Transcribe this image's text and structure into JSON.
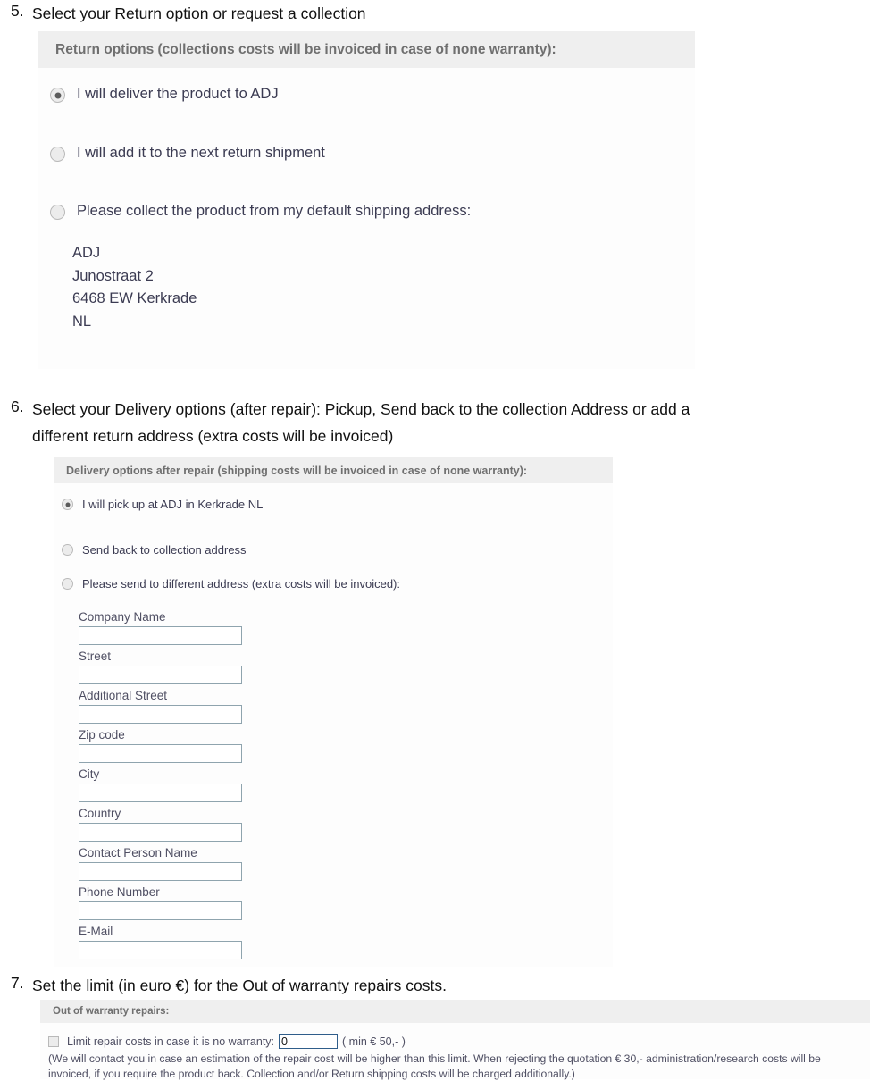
{
  "steps": [
    {
      "number": "5.",
      "text": "Select your Return option or request a collection"
    },
    {
      "number": "6.",
      "line1": "Select your Delivery options (after repair): Pickup, Send back to the collection Address or add a",
      "line2": "different return address (extra costs will be invoiced)"
    },
    {
      "number": "7.",
      "text": "Set the limit (in euro €) for the Out of warranty repairs costs."
    }
  ],
  "return_panel": {
    "header": "Return options (collections costs will be invoiced in case of none warranty):",
    "options": [
      {
        "label": "I will deliver the product to ADJ",
        "selected": true
      },
      {
        "label": "I will add it to the next return shipment",
        "selected": false
      },
      {
        "label": "Please collect the product from my default shipping address:",
        "selected": false
      }
    ],
    "address": {
      "company": "ADJ",
      "street": "Junostraat 2",
      "city_line": "6468 EW Kerkrade",
      "country": "NL"
    }
  },
  "delivery_panel": {
    "header": "Delivery options after repair (shipping costs will be invoiced in case of none warranty):",
    "options": [
      {
        "label": "I will pick up at ADJ in Kerkrade NL",
        "selected": true
      },
      {
        "label": "Send back to collection address",
        "selected": false
      },
      {
        "label": "Please send to different address (extra costs will be invoiced):",
        "selected": false
      }
    ],
    "fields": [
      {
        "label": "Company Name",
        "value": ""
      },
      {
        "label": "Street",
        "value": ""
      },
      {
        "label": "Additional Street",
        "value": ""
      },
      {
        "label": "Zip code",
        "value": ""
      },
      {
        "label": "City",
        "value": ""
      },
      {
        "label": "Country",
        "value": ""
      },
      {
        "label": "Contact Person Name",
        "value": ""
      },
      {
        "label": "Phone Number",
        "value": ""
      },
      {
        "label": "E-Mail",
        "value": ""
      }
    ]
  },
  "warranty_panel": {
    "header": "Out of warranty repairs:",
    "checkbox_checked": false,
    "checkbox_label": "Limit repair costs in case it is no warranty:",
    "limit_value": "0",
    "limit_hint": "( min € 50,- )",
    "note_line1": "(We will contact you in case an estimation of the repair cost will be higher than this limit. When rejecting the quotation € 30,- administration/research costs will be",
    "note_line2": "invoiced, if you require the product back. Collection and/or Return shipping costs will be charged additionally.)"
  },
  "colors": {
    "panel_header_bg": "#efefef",
    "panel_body_bg": "#fdfdfd",
    "header_text": "#6f6f6f",
    "option_text": "#3b3b52",
    "field_border": "#8fa4ae",
    "input_border_active": "#2f5d8a"
  }
}
